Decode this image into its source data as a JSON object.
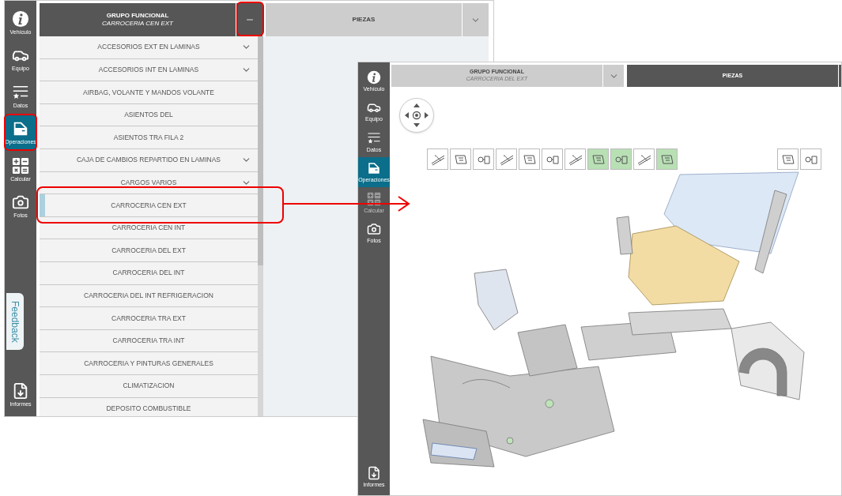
{
  "left_window": {
    "sidebar": [
      {
        "label": "Vehículo",
        "selected": false,
        "disabled": false
      },
      {
        "label": "Equipo",
        "selected": false,
        "disabled": false
      },
      {
        "label": "Datos",
        "selected": false,
        "disabled": false
      },
      {
        "label": "Operaciones",
        "selected": true,
        "disabled": false
      },
      {
        "label": "Calcular",
        "selected": false,
        "disabled": false
      },
      {
        "label": "Fotos",
        "selected": false,
        "disabled": false
      },
      {
        "label": "Informes",
        "selected": false,
        "disabled": false
      }
    ],
    "feedback_tab": "Feedback",
    "tabs": [
      {
        "title": "GRUPO FUNCIONAL",
        "subtitle": "CARROCERIA CEN EXT",
        "selected": true,
        "expanded": true
      },
      {
        "title": "PIEZAS",
        "selected": false,
        "expanded": false
      }
    ],
    "group_list": [
      {
        "label": "ACCESORIOS EXT EN LAMINAS",
        "expandable": true,
        "selected": false
      },
      {
        "label": "ACCESORIOS INT EN LAMINAS",
        "expandable": true,
        "selected": false
      },
      {
        "label": "AIRBAG, VOLANTE Y MANDOS VOLANTE",
        "expandable": false,
        "selected": false
      },
      {
        "label": "ASIENTOS DEL",
        "expandable": false,
        "selected": false
      },
      {
        "label": "ASIENTOS TRA FILA 2",
        "expandable": false,
        "selected": false
      },
      {
        "label": "CAJA DE CAMBIOS REPARTIDO EN LAMINAS",
        "expandable": true,
        "selected": false
      },
      {
        "label": "CARGOS VARIOS",
        "expandable": true,
        "selected": false
      },
      {
        "label": "CARROCERIA CEN EXT",
        "expandable": false,
        "selected": true
      },
      {
        "label": "CARROCERIA CEN INT",
        "expandable": false,
        "selected": false
      },
      {
        "label": "CARROCERIA DEL EXT",
        "expandable": false,
        "selected": false
      },
      {
        "label": "CARROCERIA DEL INT",
        "expandable": false,
        "selected": false
      },
      {
        "label": "CARROCERIA DEL INT REFRIGERACION",
        "expandable": false,
        "selected": false
      },
      {
        "label": "CARROCERIA TRA EXT",
        "expandable": false,
        "selected": false
      },
      {
        "label": "CARROCERIA TRA INT",
        "expandable": false,
        "selected": false
      },
      {
        "label": "CARROCERIA Y PINTURAS GENERALES",
        "expandable": false,
        "selected": false
      },
      {
        "label": "CLIMATIZACION",
        "expandable": false,
        "selected": false
      },
      {
        "label": "DEPOSITO COMBUSTIBLE",
        "expandable": false,
        "selected": false
      }
    ]
  },
  "right_window": {
    "sidebar": [
      {
        "label": "Vehículo",
        "selected": false,
        "disabled": false
      },
      {
        "label": "Equipo",
        "selected": false,
        "disabled": false
      },
      {
        "label": "Datos",
        "selected": false,
        "disabled": false
      },
      {
        "label": "Operaciones",
        "selected": true,
        "disabled": false
      },
      {
        "label": "Calcular",
        "selected": false,
        "disabled": true
      },
      {
        "label": "Fotos",
        "selected": false,
        "disabled": false
      },
      {
        "label": "Informes",
        "selected": false,
        "disabled": false
      }
    ],
    "tabs": [
      {
        "title": "GRUPO FUNCIONAL",
        "subtitle": "CARROCERIA DEL EXT",
        "selected": false,
        "expanded": false
      },
      {
        "title": "PIEZAS",
        "selected": true,
        "expanded": false
      }
    ],
    "part_thumbnails": [
      {
        "selected": false
      },
      {
        "selected": false
      },
      {
        "selected": false
      },
      {
        "selected": false
      },
      {
        "selected": false
      },
      {
        "selected": false
      },
      {
        "selected": false
      },
      {
        "selected": true
      },
      {
        "selected": true
      },
      {
        "selected": false
      },
      {
        "selected": true
      }
    ],
    "extra_thumbnails": [
      {
        "selected": false
      },
      {
        "selected": false
      }
    ]
  }
}
